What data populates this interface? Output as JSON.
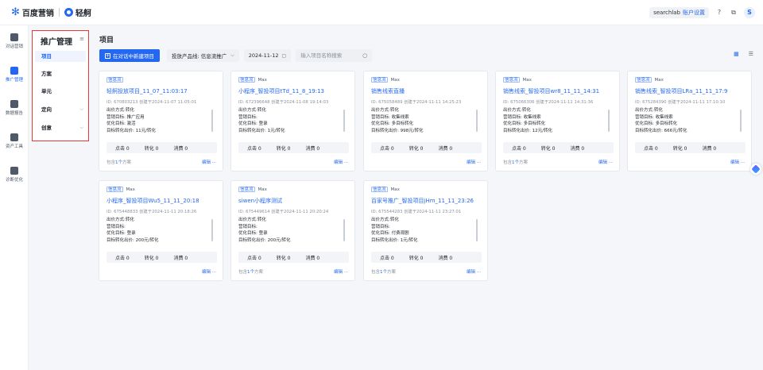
{
  "header": {
    "brand": "百度营销",
    "product": "轻舸",
    "account_name": "searchlab",
    "account_settings": "账户设置",
    "help_icon": "help-icon",
    "switch_icon": "switch-icon",
    "avatar_letter": "S"
  },
  "rail": {
    "items": [
      {
        "label": "对话营销",
        "icon": "chat-icon"
      },
      {
        "label": "推广管理",
        "icon": "chart-icon",
        "active": true
      },
      {
        "label": "数据报告",
        "icon": "report-icon"
      },
      {
        "label": "资产工具",
        "icon": "toolbox-icon"
      },
      {
        "label": "诊断优化",
        "icon": "shield-icon"
      }
    ]
  },
  "subnav": {
    "title": "推广管理",
    "items": [
      {
        "label": "项目",
        "active": true
      },
      {
        "label": "方案"
      },
      {
        "label": "单元"
      },
      {
        "label": "定向",
        "expandable": true
      },
      {
        "label": "创意",
        "expandable": true
      }
    ]
  },
  "main": {
    "title": "项目",
    "new_button": "在对话中新建项目",
    "product_line_label": "投放产品线:",
    "product_line_value": "信息流推广",
    "date": "2024-11-12",
    "search_placeholder": "输入项目名称搜索"
  },
  "cards": [
    {
      "tag": "信息流",
      "max": "",
      "title": "轻舸投放项目_11_07_11:03:17",
      "meta": "ID: 670803213  创建于2024-11-07 11:05:01",
      "d1": "出价方式:转化",
      "d2": "营销目标: 推广应用",
      "d3": "优化目标: 激活",
      "d4": "目标转化出价: 11元/转化",
      "click": "点击 0",
      "conv": "转化 0",
      "cost": "消费 0",
      "foot_prefix": "包含",
      "foot_count": "1个",
      "foot_suffix": "方案",
      "actions": "编辑 ···"
    },
    {
      "tag": "信息流",
      "max": "Max",
      "title": "小程序_智投项目tTd_11_8_19:13",
      "meta": "ID: 672396648  创建于2024-11-08 19:14:03",
      "d1": "出价方式:转化",
      "d2": "营销目标:",
      "d3": "优化目标: 登录",
      "d4": "目标转化出价: 1元/转化",
      "click": "点击 0",
      "conv": "转化 0",
      "cost": "消费 0",
      "foot_prefix": "",
      "foot_count": "",
      "foot_suffix": "",
      "actions": "编辑 ···"
    },
    {
      "tag": "信息流",
      "max": "Max",
      "title": "销售线索直播",
      "meta": "ID: 675058489  创建于2024-11-11 14:25:23",
      "d1": "出价方式:转化",
      "d2": "营销目标: 收集线索",
      "d3": "优化目标: 多目标转化",
      "d4": "目标转化出价: 998元/转化",
      "click": "点击 0",
      "conv": "转化 0",
      "cost": "消费 0",
      "foot_prefix": "",
      "foot_count": "",
      "foot_suffix": "",
      "actions": "编辑 ···"
    },
    {
      "tag": "信息流",
      "max": "Max",
      "title": "销售线索_智投项目wr8_11_11_14:31",
      "meta": "ID: 675066306  创建于2024-11-11 14:31:36",
      "d1": "出价方式:转化",
      "d2": "营销目标: 收集线索",
      "d3": "优化目标: 多目标转化",
      "d4": "目标转化出价: 12元/转化",
      "click": "点击 0",
      "conv": "转化 0",
      "cost": "消费 0",
      "foot_prefix": "包含",
      "foot_count": "1个",
      "foot_suffix": "方案",
      "actions": "编辑 ···"
    },
    {
      "tag": "信息流",
      "max": "Max",
      "title": "销售线索_智投项目LRa_11_11_17:9",
      "meta": "ID: 675284390  创建于2024-11-11 17:10:10",
      "d1": "出价方式:转化",
      "d2": "营销目标: 收集线索",
      "d3": "优化目标: 多目标转化",
      "d4": "目标转化出价: 666元/转化",
      "click": "点击 0",
      "conv": "转化 0",
      "cost": "消费 0",
      "foot_prefix": "",
      "foot_count": "",
      "foot_suffix": "",
      "actions": "编辑 ···"
    },
    {
      "tag": "信息流",
      "max": "Max",
      "title": "小程序_智投项目Wu5_11_11_20:18",
      "meta": "ID: 675448833  创建于2024-11-11 20:18:26",
      "d1": "出价方式:转化",
      "d2": "营销目标:",
      "d3": "优化目标: 登录",
      "d4": "目标转化出价: 200元/转化",
      "click": "点击 0",
      "conv": "转化 0",
      "cost": "消费 0",
      "foot_prefix": "",
      "foot_count": "",
      "foot_suffix": "",
      "actions": "编辑 ···"
    },
    {
      "tag": "信息流",
      "max": "Max",
      "title": "siwen小程序测试",
      "meta": "ID: 675449614  创建于2024-11-11 20:20:24",
      "d1": "出价方式:转化",
      "d2": "营销目标:",
      "d3": "优化目标: 登录",
      "d4": "目标转化出价: 200元/转化",
      "click": "点击 0",
      "conv": "转化 0",
      "cost": "消费 0",
      "foot_prefix": "包含",
      "foot_count": "1个",
      "foot_suffix": "方案",
      "actions": "编辑 ···"
    },
    {
      "tag": "信息流",
      "max": "Max",
      "title": "百家号推广_智投项目jHm_11_11_23:26",
      "meta": "ID: 675544283  创建于2024-11-11 23:27:01",
      "d1": "出价方式:转化",
      "d2": "营销目标:",
      "d3": "优化目标: 付费观剧",
      "d4": "目标转化出价: 1元/转化",
      "click": "点击 0",
      "conv": "转化 0",
      "cost": "消费 0",
      "foot_prefix": "包含",
      "foot_count": "1个",
      "foot_suffix": "方案",
      "actions": "编辑 ···"
    }
  ]
}
